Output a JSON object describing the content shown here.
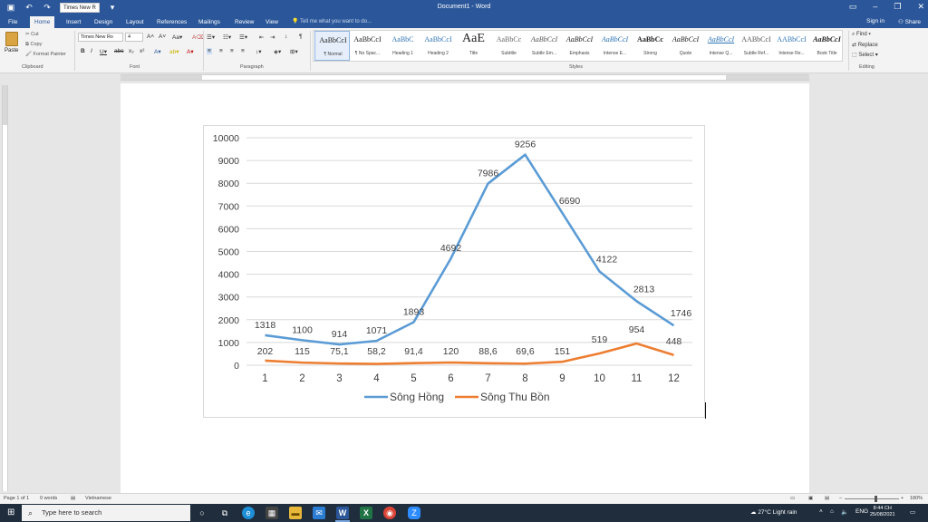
{
  "window": {
    "title": "Document1 - Word",
    "qat_font": "Times New R",
    "controls": {
      "ribbon": "▭",
      "minimize": "–",
      "restore": "❐",
      "close": "✕"
    }
  },
  "tabs": [
    "File",
    "Home",
    "Insert",
    "Design",
    "Layout",
    "References",
    "Mailings",
    "Review",
    "View"
  ],
  "active_tab": "Home",
  "tell_me": "Tell me what you want to do...",
  "sign_in": "Sign in",
  "share": "Share",
  "ribbon": {
    "clipboard": {
      "paste": "Paste",
      "cut": "Cut",
      "copy": "Copy",
      "format_painter": "Format Painter",
      "label": "Clipboard"
    },
    "font": {
      "name": "Times New Ro",
      "size": "4",
      "label": "Font"
    },
    "paragraph": {
      "label": "Paragraph"
    },
    "styles": {
      "label": "Styles",
      "items": [
        {
          "sample": "AaBbCcI",
          "name": "¶ Normal"
        },
        {
          "sample": "AaBbCcI",
          "name": "¶ No Spac..."
        },
        {
          "sample": "AaBbC",
          "name": "Heading 1"
        },
        {
          "sample": "AaBbCcI",
          "name": "Heading 2"
        },
        {
          "sample": "AaE",
          "name": "Title"
        },
        {
          "sample": "AaBbCc",
          "name": "Subtitle"
        },
        {
          "sample": "AaBbCcI",
          "name": "Subtle Em..."
        },
        {
          "sample": "AaBbCcI",
          "name": "Emphasis"
        },
        {
          "sample": "AaBbCcI",
          "name": "Intense E..."
        },
        {
          "sample": "AaBbCc",
          "name": "Strong"
        },
        {
          "sample": "AaBbCcI",
          "name": "Quote"
        },
        {
          "sample": "AaBbCcI",
          "name": "Intense Q..."
        },
        {
          "sample": "AABbCcI",
          "name": "Subtle Ref..."
        },
        {
          "sample": "AABbCcI",
          "name": "Intense Re..."
        },
        {
          "sample": "AaBbCcI",
          "name": "Book Title"
        }
      ]
    },
    "editing": {
      "find": "Find",
      "replace": "Replace",
      "select": "Select",
      "label": "Editing"
    }
  },
  "status": {
    "page": "Page 1 of 1",
    "words": "0 words",
    "language": "Vietnamese",
    "zoom": "180%"
  },
  "taskbar": {
    "search_placeholder": "Type here to search",
    "weather": "27°C  Light rain",
    "lang": "ENG",
    "time": "8:44 CH",
    "date": "25/08/2021"
  },
  "colors": {
    "word_blue": "#2b579a",
    "series1": "#5b9bd5",
    "series2": "#ed7d31"
  },
  "chart_data": {
    "type": "line",
    "x": [
      1,
      2,
      3,
      4,
      5,
      6,
      7,
      8,
      9,
      10,
      11,
      12
    ],
    "ylim": [
      0,
      10000
    ],
    "yticks": [
      0,
      1000,
      2000,
      3000,
      4000,
      5000,
      6000,
      7000,
      8000,
      9000,
      10000
    ],
    "grid": true,
    "legend": "bottom",
    "series": [
      {
        "name": "Sông Hồng",
        "color": "#5b9bd5",
        "values": [
          1318,
          1100,
          914,
          1071,
          1893,
          4692,
          7986,
          9256,
          6690,
          4122,
          2813,
          1746
        ],
        "labels": [
          "1318",
          "1100",
          "914",
          "1071",
          "1893",
          "4692",
          "7986",
          "9256",
          "6690",
          "4122",
          "2813",
          "1746"
        ]
      },
      {
        "name": "Sông Thu Bồn",
        "color": "#ed7d31",
        "values": [
          202,
          115,
          75.1,
          58.2,
          91.4,
          120,
          88.6,
          69.6,
          151,
          519,
          954,
          448
        ],
        "labels": [
          "202",
          "115",
          "75,1",
          "58,2",
          "91,4",
          "120",
          "88,6",
          "69,6",
          "151",
          "519",
          "954",
          "448"
        ]
      }
    ]
  }
}
